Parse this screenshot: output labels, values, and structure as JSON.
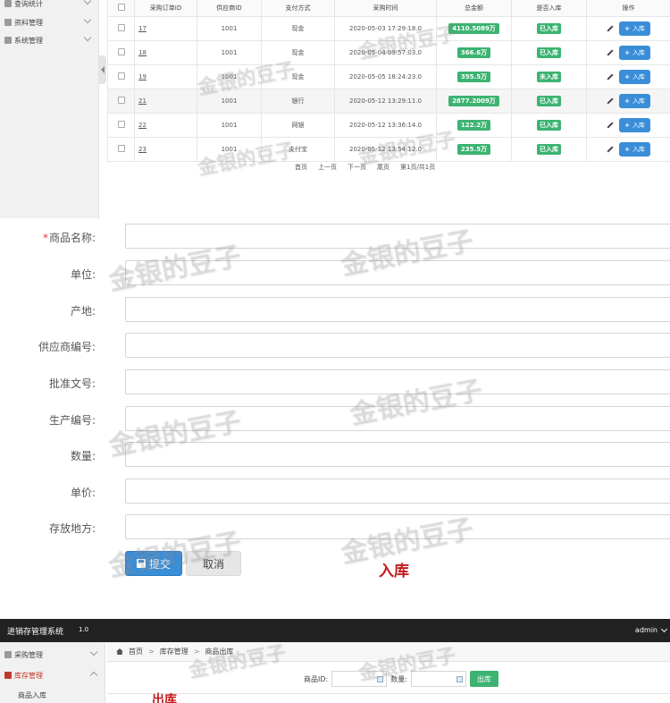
{
  "sidebar_top": {
    "items": [
      {
        "label": "查询统计"
      },
      {
        "label": "资料管理"
      },
      {
        "label": "系统管理"
      }
    ]
  },
  "orders_table": {
    "headers": [
      "",
      "采购订单ID",
      "供应商ID",
      "支付方式",
      "采购时间",
      "总金额",
      "是否入库",
      "操作"
    ],
    "rows": [
      {
        "id": "17",
        "supplier": "1001",
        "pay": "现金",
        "time": "2020-05-03 17:29:18.0",
        "amount": "4110.5089万",
        "status": "已入库"
      },
      {
        "id": "18",
        "supplier": "1001",
        "pay": "现金",
        "time": "2020-05-04 09:57:03.0",
        "amount": "366.6万",
        "status": "已入库"
      },
      {
        "id": "19",
        "supplier": "1001",
        "pay": "现金",
        "time": "2020-05-05 18:24:23.0",
        "amount": "355.5万",
        "status": "未入库"
      },
      {
        "id": "21",
        "supplier": "1001",
        "pay": "银行",
        "time": "2020-05-12 13:29:11.0",
        "amount": "2877.2009万",
        "status": "已入库"
      },
      {
        "id": "22",
        "supplier": "1001",
        "pay": "网银",
        "time": "2020-05-12 13:36:14.0",
        "amount": "122.2万",
        "status": "已入库"
      },
      {
        "id": "23",
        "supplier": "1001",
        "pay": "支付宝",
        "time": "2020-05-12 13:54:12.0",
        "amount": "235.5万",
        "status": "已入库"
      }
    ],
    "action_label": "入库"
  },
  "pager": {
    "first": "首页",
    "prev": "上一页",
    "next": "下一页",
    "last": "尾页",
    "info": "第1页/共1页"
  },
  "form": {
    "fields": [
      {
        "label": "商品名称:",
        "required": true,
        "value": ""
      },
      {
        "label": "单位:",
        "required": false,
        "value": ""
      },
      {
        "label": "产地:",
        "required": false,
        "value": ""
      },
      {
        "label": "供应商编号:",
        "required": false,
        "value": ""
      },
      {
        "label": "批准文号:",
        "required": false,
        "value": ""
      },
      {
        "label": "生产编号:",
        "required": false,
        "value": ""
      },
      {
        "label": "数量:",
        "required": false,
        "value": ""
      },
      {
        "label": "单价:",
        "required": false,
        "value": ""
      },
      {
        "label": "存放地方:",
        "required": false,
        "value": ""
      }
    ],
    "required_mark": "*",
    "submit_label": "提交",
    "cancel_label": "取消",
    "caption": "入库"
  },
  "outbound": {
    "app_title": "进销存管理系统",
    "app_version": "1.0",
    "user": "admin",
    "sidebar": [
      {
        "label": "采购管理"
      },
      {
        "label": "库存管理"
      }
    ],
    "sidebar_sub": "商品入库",
    "breadcrumb": [
      "首页",
      "库存管理",
      "商品出库"
    ],
    "breadcrumb_sep": ">",
    "product_id_label": "商品ID:",
    "qty_label": "数量:",
    "out_button": "出库",
    "caption": "出库"
  },
  "watermark": "金银的豆子",
  "colors": {
    "primary": "#3a8ed8",
    "success": "#3cb371",
    "caption_red": "#c41a1a",
    "topbar": "#222222"
  }
}
